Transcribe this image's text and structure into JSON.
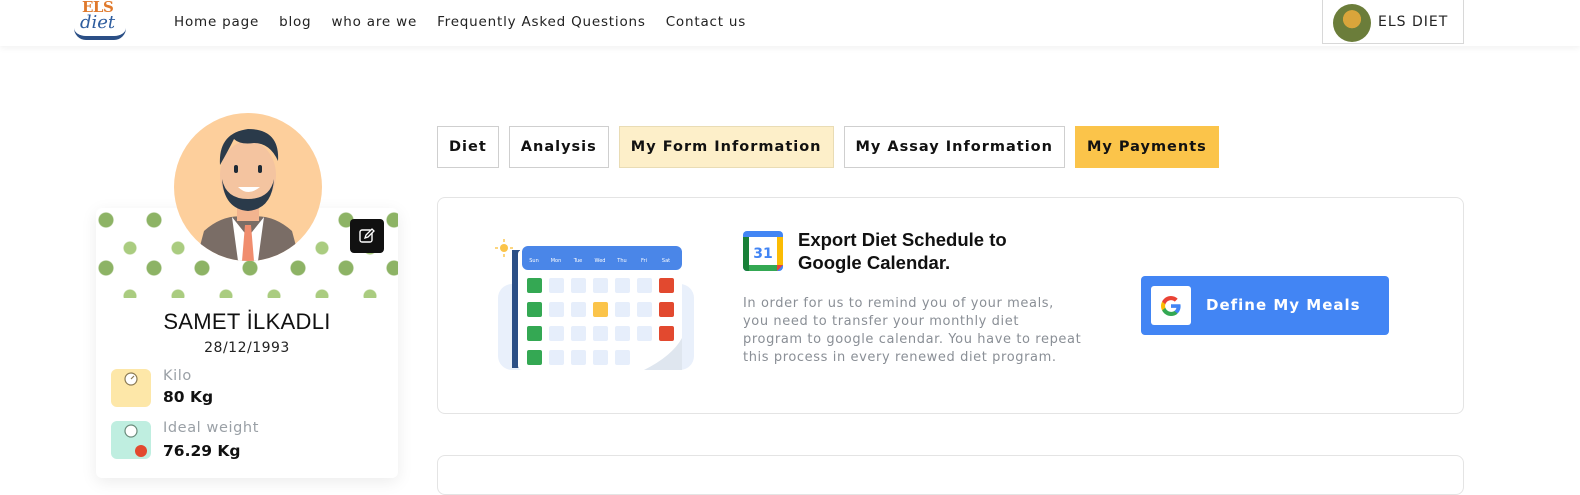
{
  "brand": {
    "logo_top": "ELS",
    "logo_bottom": "diet"
  },
  "nav": {
    "items": [
      "Home page",
      "blog",
      "who are we",
      "Frequently Asked Questions",
      "Contact us"
    ]
  },
  "user_menu": {
    "name": "ELS DIET"
  },
  "profile": {
    "name": "SAMET İLKADLI",
    "birth_date": "28/12/1993",
    "stats": [
      {
        "label": "Kilo",
        "value": "80 Kg",
        "icon": "scale-icon",
        "color": "#fde7a8"
      },
      {
        "label": "Ideal weight",
        "value": "76.29 Kg",
        "icon": "apple-scale-icon",
        "color": "#bfeee0"
      }
    ]
  },
  "tabs": [
    {
      "label": "Diet",
      "state": "default"
    },
    {
      "label": "Analysis",
      "state": "default"
    },
    {
      "label": "My Form Information",
      "state": "light"
    },
    {
      "label": "My Assay Information",
      "state": "default"
    },
    {
      "label": "My Payments",
      "state": "active"
    }
  ],
  "export": {
    "title": "Export Diet Schedule to Google Calendar.",
    "description": "In order for us to remind you of your meals, you need to transfer your monthly diet program to google calendar. You have to repeat this process in every renewed diet program.",
    "gcal_day": "31",
    "button_label": "Define My Meals"
  },
  "calendar_illustration": {
    "days": [
      "Sun",
      "Mon",
      "Tue",
      "Wed",
      "Thu",
      "Fri",
      "Sat"
    ]
  },
  "colors": {
    "accent": "#fbc44a",
    "accent_light": "#fdefc9",
    "google_blue": "#4285f4",
    "avatar_bg": "#fdcf9c"
  }
}
